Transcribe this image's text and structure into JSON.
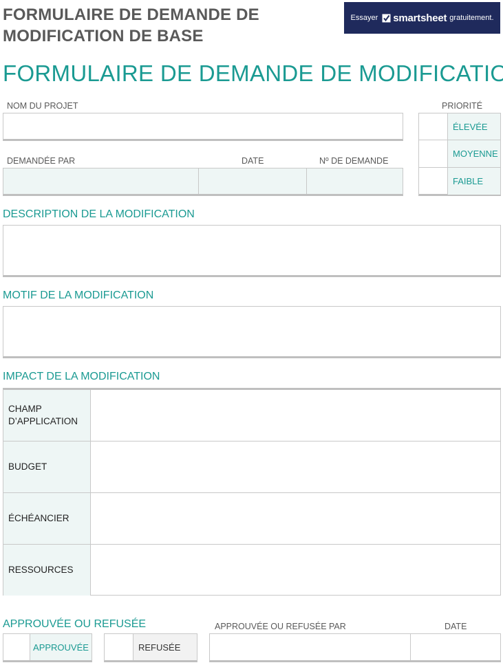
{
  "header": {
    "doc_title_line1": "FORMULAIRE DE DEMANDE DE",
    "doc_title_line2": "MODIFICATION DE BASE",
    "banner": {
      "prefix": "Essayer",
      "brand": "smartsheet",
      "suffix": "gratuitement.",
      "bg_color": "#1f2a5c"
    }
  },
  "form_title": "FORMULAIRE DE DEMANDE DE MODIFICATION",
  "project": {
    "name_label": "NOM DU PROJET",
    "name_value": "",
    "requested_by_label": "DEMANDÉE PAR",
    "requested_by_value": "",
    "date_label": "DATE",
    "date_value": "",
    "request_no_label": "Nº DE DEMANDE",
    "request_no_value": ""
  },
  "priority": {
    "label": "PRIORITÉ",
    "options": [
      "ÉLEVÉE",
      "MOYENNE",
      "FAIBLE"
    ]
  },
  "sections": {
    "description": "DESCRIPTION DE LA MODIFICATION",
    "reason": "MOTIF DE LA MODIFICATION",
    "impact": "IMPACT DE LA MODIFICATION",
    "approval": "APPROUVÉE OU REFUSÉE"
  },
  "impact_rows": [
    "CHAMP D’APPLICATION",
    "BUDGET",
    "ÉCHÉANCIER",
    "RESSOURCES"
  ],
  "approval": {
    "approved_label": "APPROUVÉE",
    "refused_label": "REFUSÉE",
    "by_label": "APPROUVÉE OU REFUSÉE PAR",
    "date_label": "DATE"
  },
  "colors": {
    "accent": "#1a9a92",
    "tint": "#eef6f5",
    "grey_tint": "#f2f2f2",
    "border": "#c8c8c8"
  }
}
